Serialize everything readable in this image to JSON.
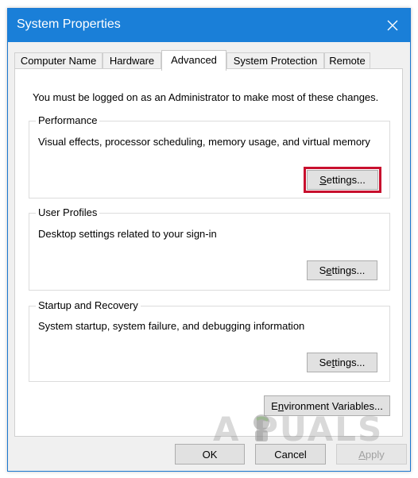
{
  "window": {
    "title": "System Properties",
    "close_icon": "close-icon"
  },
  "tabs": [
    {
      "label": "Computer Name"
    },
    {
      "label": "Hardware"
    },
    {
      "label": "Advanced",
      "active": true
    },
    {
      "label": "System Protection"
    },
    {
      "label": "Remote"
    }
  ],
  "notice": "You must be logged on as an Administrator to make most of these changes.",
  "groups": {
    "performance": {
      "title": "Performance",
      "description": "Visual effects, processor scheduling, memory usage, and virtual memory",
      "button": {
        "pre": "",
        "ul": "S",
        "post": "ettings..."
      }
    },
    "user_profiles": {
      "title": "User Profiles",
      "description": "Desktop settings related to your sign-in",
      "button": {
        "pre": "S",
        "ul": "e",
        "post": "ttings..."
      }
    },
    "startup_recovery": {
      "title": "Startup and Recovery",
      "description": "System startup, system failure, and debugging information",
      "button": {
        "pre": "Se",
        "ul": "t",
        "post": "tings..."
      }
    }
  },
  "env_button": {
    "pre": "E",
    "ul": "n",
    "post": "vironment Variables..."
  },
  "dialog_buttons": {
    "ok": "OK",
    "cancel": "Cancel",
    "apply": {
      "ul": "A",
      "post": "pply"
    }
  },
  "watermark": "A  PUALS",
  "colors": {
    "titlebar": "#1a7fd8",
    "highlight": "#c8102e"
  }
}
